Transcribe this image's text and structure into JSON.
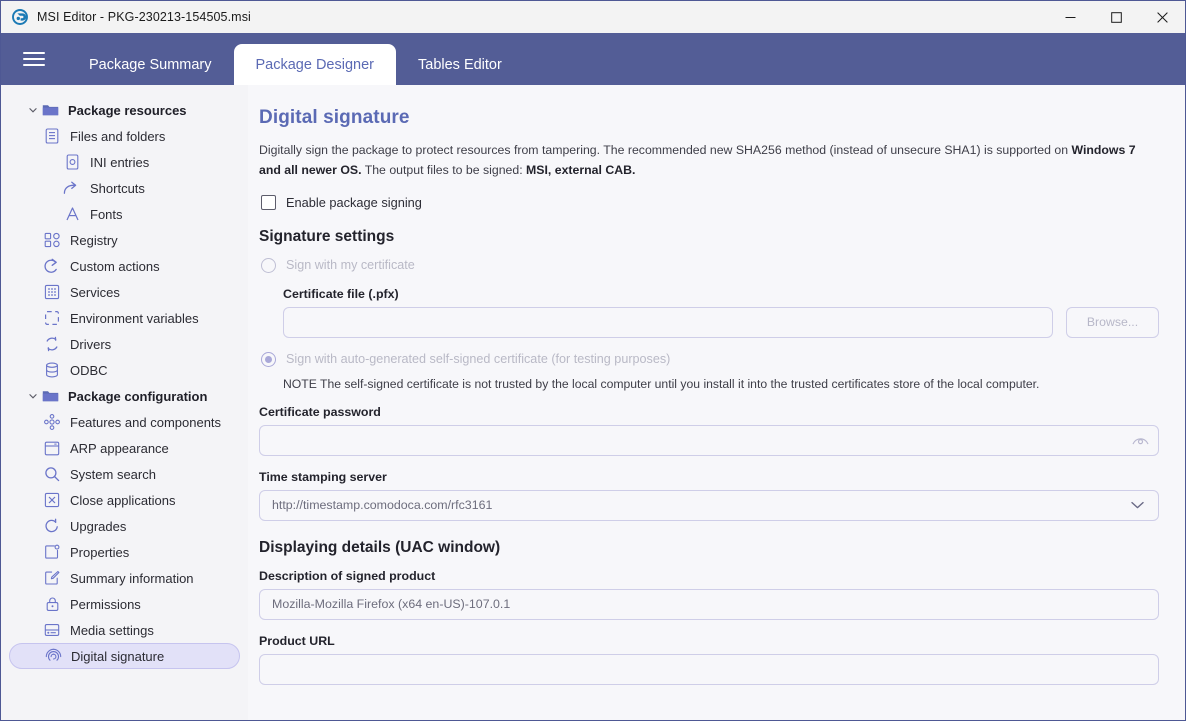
{
  "window": {
    "app_icon": "msi-editor-logo-icon",
    "title": "MSI Editor - PKG-230213-154505.msi",
    "minimize_label": "—",
    "maximize_label": "☐",
    "close_label": "✕"
  },
  "tabbar": {
    "menu_icon": "hamburger-menu-icon",
    "tabs": [
      {
        "label": "Package Summary",
        "active": false
      },
      {
        "label": "Package Designer",
        "active": true
      },
      {
        "label": "Tables Editor",
        "active": false
      }
    ]
  },
  "sidebar": {
    "items": [
      {
        "label": "Package resources",
        "icon": "folder-icon",
        "indent": 0,
        "group": true,
        "expanded": true,
        "selected": false
      },
      {
        "label": "Files and folders",
        "icon": "file-list-icon",
        "indent": 1,
        "group": false,
        "expanded": null,
        "selected": false
      },
      {
        "label": "INI entries",
        "icon": "ini-file-icon",
        "indent": 2,
        "group": false,
        "expanded": null,
        "selected": false
      },
      {
        "label": "Shortcuts",
        "icon": "shortcut-arrow-icon",
        "indent": 2,
        "group": false,
        "expanded": null,
        "selected": false
      },
      {
        "label": "Fonts",
        "icon": "font-letter-icon",
        "indent": 2,
        "group": false,
        "expanded": null,
        "selected": false
      },
      {
        "label": "Registry",
        "icon": "registry-blocks-icon",
        "indent": 1,
        "group": false,
        "expanded": null,
        "selected": false
      },
      {
        "label": "Custom actions",
        "icon": "custom-action-arrow-icon",
        "indent": 1,
        "group": false,
        "expanded": null,
        "selected": false
      },
      {
        "label": "Services",
        "icon": "services-grid-icon",
        "indent": 1,
        "group": false,
        "expanded": null,
        "selected": false
      },
      {
        "label": "Environment variables",
        "icon": "dashed-square-icon",
        "indent": 1,
        "group": false,
        "expanded": null,
        "selected": false
      },
      {
        "label": "Drivers",
        "icon": "drivers-refresh-icon",
        "indent": 1,
        "group": false,
        "expanded": null,
        "selected": false
      },
      {
        "label": "ODBC",
        "icon": "database-icon",
        "indent": 1,
        "group": false,
        "expanded": null,
        "selected": false
      },
      {
        "label": "Package configuration",
        "icon": "folder-icon",
        "indent": 0,
        "group": true,
        "expanded": true,
        "selected": false
      },
      {
        "label": "Features and components",
        "icon": "components-node-icon",
        "indent": 1,
        "group": false,
        "expanded": null,
        "selected": false
      },
      {
        "label": "ARP appearance",
        "icon": "window-icon",
        "indent": 1,
        "group": false,
        "expanded": null,
        "selected": false
      },
      {
        "label": "System search",
        "icon": "search-icon",
        "indent": 1,
        "group": false,
        "expanded": null,
        "selected": false
      },
      {
        "label": "Close applications",
        "icon": "close-box-icon",
        "indent": 1,
        "group": false,
        "expanded": null,
        "selected": false
      },
      {
        "label": "Upgrades",
        "icon": "refresh-circle-icon",
        "indent": 1,
        "group": false,
        "expanded": null,
        "selected": false
      },
      {
        "label": "Properties",
        "icon": "properties-icon",
        "indent": 1,
        "group": false,
        "expanded": null,
        "selected": false
      },
      {
        "label": "Summary information",
        "icon": "edit-pencil-icon",
        "indent": 1,
        "group": false,
        "expanded": null,
        "selected": false
      },
      {
        "label": "Permissions",
        "icon": "lock-icon",
        "indent": 1,
        "group": false,
        "expanded": null,
        "selected": false
      },
      {
        "label": "Media settings",
        "icon": "media-disk-icon",
        "indent": 1,
        "group": false,
        "expanded": null,
        "selected": false
      },
      {
        "label": "Digital signature",
        "icon": "fingerprint-icon",
        "indent": 1,
        "group": false,
        "expanded": null,
        "selected": true
      }
    ]
  },
  "main": {
    "page_title": "Digital signature",
    "description_part1": "Digitally sign the package to protect resources from tampering. The recommended new SHA256 method (instead of unsecure SHA1) is supported on ",
    "description_bold1": "Windows 7 and all newer OS.",
    "description_part2": " The output files to be signed: ",
    "description_bold2": "MSI, external CAB.",
    "enable_signing_label": "Enable package signing",
    "enable_signing_checked": false,
    "signature_settings_heading": "Signature settings",
    "radio_own_cert_label": "Sign with my certificate",
    "radio_own_cert_selected": false,
    "certificate_file_label": "Certificate file (.pfx)",
    "certificate_file_value": "",
    "browse_button_label": "Browse...",
    "radio_self_signed_label": "Sign with auto-generated self-signed certificate (for testing purposes)",
    "radio_self_signed_selected": true,
    "self_signed_note": "NOTE The self-signed certificate is not trusted by the local computer until you install it into the trusted certificates store of the local computer.",
    "certificate_password_label": "Certificate password",
    "certificate_password_value": "",
    "password_reveal_icon": "eye-icon",
    "timestamp_server_label": "Time stamping server",
    "timestamp_server_value": "http://timestamp.comodoca.com/rfc3161",
    "timestamp_dropdown_icon": "chevron-down-icon",
    "uac_heading": "Displaying details (UAC window)",
    "product_description_label": "Description of signed product",
    "product_description_value": "Mozilla-Mozilla Firefox (x64 en-US)-107.0.1",
    "product_url_label": "Product URL",
    "product_url_value": ""
  },
  "colors": {
    "tabbar": "#535d96",
    "accent_title": "#5b6ab4",
    "sidebar_bg": "#f4f4f7",
    "content_bg": "#f7f7fa",
    "selected_item_bg": "#e2e1f8",
    "icon_purple": "#6a74c9",
    "input_border": "#cfcee8"
  }
}
